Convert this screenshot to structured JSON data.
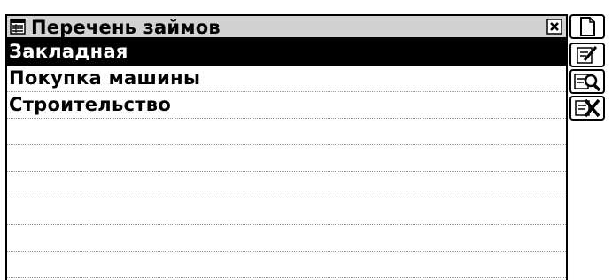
{
  "window": {
    "title": "Перечень займов",
    "title_icon": "list-window-icon",
    "close_icon": "close-icon"
  },
  "list": {
    "items": [
      {
        "label": "Закладная",
        "selected": true
      },
      {
        "label": "Покупка машины",
        "selected": false
      },
      {
        "label": "Строительство",
        "selected": false
      }
    ],
    "empty_rows": 6
  },
  "toolbar": {
    "buttons": [
      {
        "name": "new-document-icon"
      },
      {
        "name": "edit-icon"
      },
      {
        "name": "view-search-icon"
      },
      {
        "name": "delete-icon"
      }
    ]
  },
  "colors": {
    "titlebar_bg": "#d2d2d2",
    "selection_bg": "#000000",
    "selection_text": "#ffffff",
    "row_separator": "#9a9a9a"
  }
}
